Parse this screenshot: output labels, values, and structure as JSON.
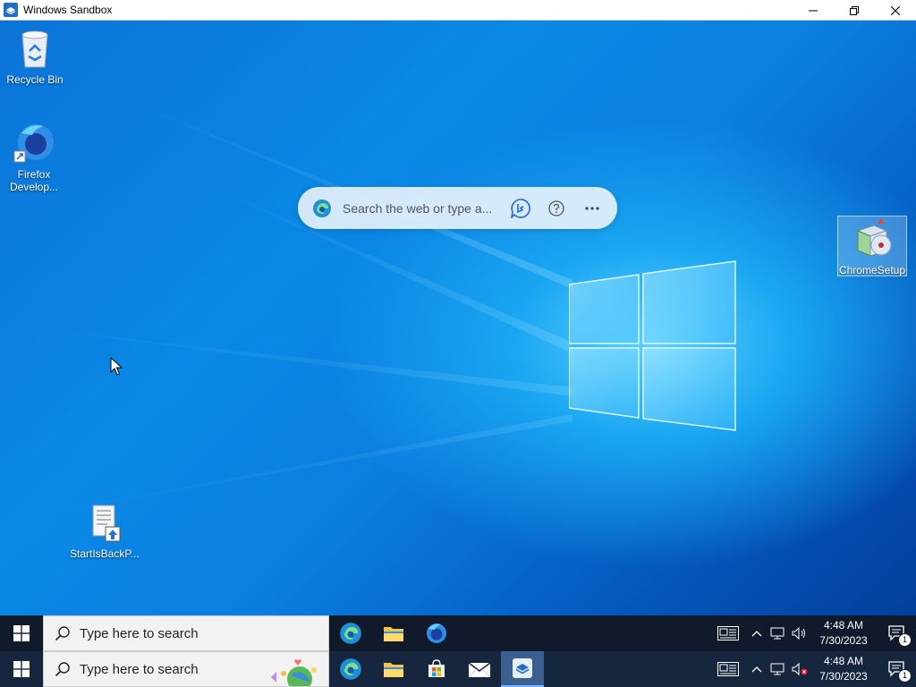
{
  "window": {
    "title": "Windows Sandbox",
    "controls": {
      "minimize": "minimize",
      "maximize": "maximize",
      "close": "close"
    }
  },
  "desktop": {
    "icons": [
      {
        "label": "Recycle Bin",
        "icon": "recycle-bin-icon"
      },
      {
        "label": "Firefox Develop...",
        "label_line1": "Firefox",
        "label_line2": "Develop...",
        "icon": "firefox-developer-icon"
      },
      {
        "label": "ChromeSetup",
        "icon": "installer-icon",
        "selected": true
      },
      {
        "label": "StartIsBackP...",
        "icon": "document-installer-icon"
      }
    ],
    "edge_search": {
      "placeholder": "Search the web or type a...",
      "icons": [
        "edge-icon",
        "bing-chat-icon",
        "help-icon",
        "more-icon"
      ]
    }
  },
  "taskbars": [
    {
      "search_placeholder": "Type here to search",
      "apps": [
        "edge-icon",
        "file-explorer-icon",
        "firefox-icon"
      ],
      "time": "4:48 AM",
      "date": "7/30/2023",
      "notification_count": "1"
    },
    {
      "search_placeholder": "Type here to search",
      "apps": [
        "edge-icon",
        "file-explorer-icon",
        "store-icon",
        "mail-icon",
        "sandbox-icon"
      ],
      "active_app": "sandbox-icon",
      "time": "4:48 AM",
      "date": "7/30/2023",
      "notification_count": "1"
    }
  ],
  "colors": {
    "desktop_blue": "#0a7fe0",
    "taskbar_dark": "#101a2a",
    "taskbar_blue": "#16263e",
    "accent": "#0078d4"
  }
}
